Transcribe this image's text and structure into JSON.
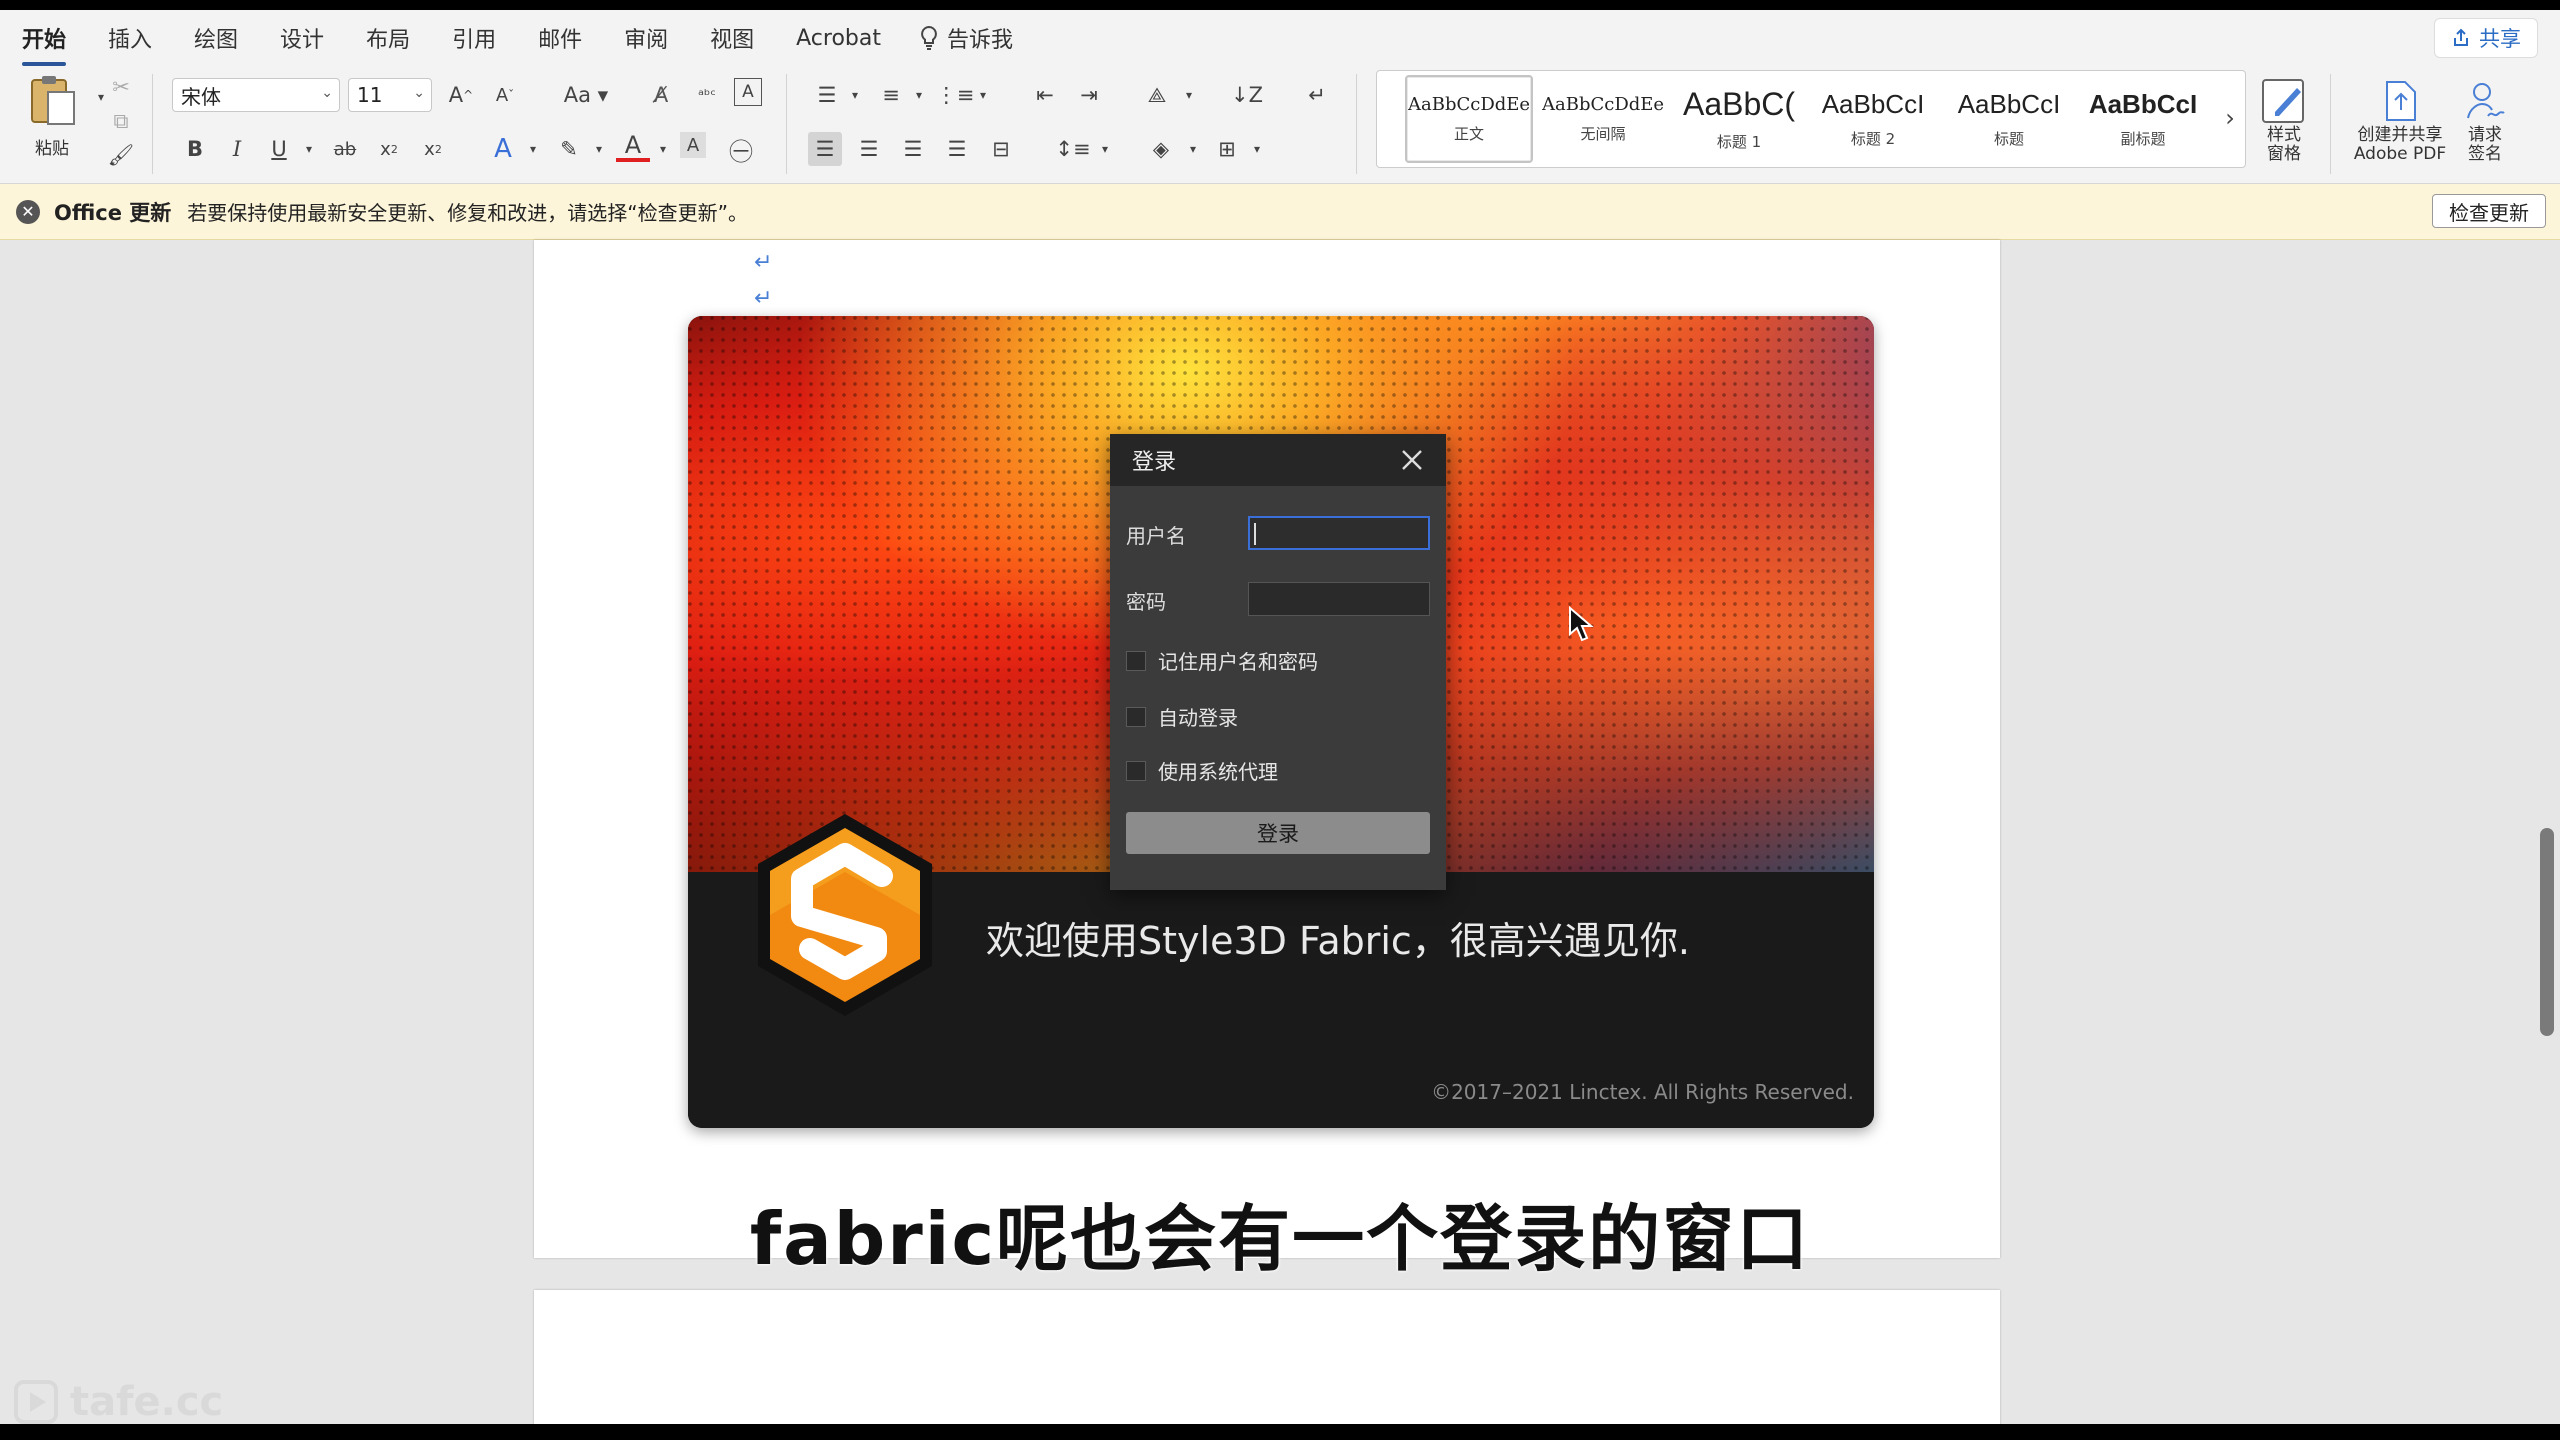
{
  "menubar": {
    "tabs": [
      "开始",
      "插入",
      "绘图",
      "设计",
      "布局",
      "引用",
      "邮件",
      "审阅",
      "视图",
      "Acrobat"
    ],
    "tell_me": "告诉我",
    "share": "共享"
  },
  "ribbon": {
    "paste_label": "粘贴",
    "font_name": "宋体",
    "font_size": "11",
    "styles": [
      {
        "sample": "AaBbCcDdEe",
        "label": "正文"
      },
      {
        "sample": "AaBbCcDdEe",
        "label": "无间隔"
      },
      {
        "sample": "AaBbC(",
        "label": "标题 1"
      },
      {
        "sample": "AaBbCcI",
        "label": "标题 2"
      },
      {
        "sample": "AaBbCcI",
        "label": "标题"
      },
      {
        "sample": "AaBbCcI",
        "label": "副标题"
      }
    ],
    "styles_pane": "样式\n窗格",
    "create_pdf": "创建并共享\nAdobe PDF",
    "request_sign": "请求\n签名"
  },
  "notification": {
    "title": "Office 更新",
    "message": "若要保持使用最新安全更新、修复和改进，请选择“检查更新”。",
    "button": "检查更新"
  },
  "image": {
    "dialog": {
      "title": "登录",
      "username_label": "用户名",
      "password_label": "密码",
      "remember": "记住用户名和密码",
      "auto_login": "自动登录",
      "use_proxy": "使用系统代理",
      "login_button": "登录"
    },
    "welcome": "欢迎使用Style3D Fabric，很高兴遇见你.",
    "copyright": "©2017–2021 Linctex.  All Rights Reserved."
  },
  "subtitle": "fabric呢也会有一个登录的窗口",
  "watermark": "tafe.cc",
  "colors": {
    "accent": "#2b579a",
    "logo_orange": "#f28a12",
    "dialog_bg": "#3b3b3b"
  }
}
